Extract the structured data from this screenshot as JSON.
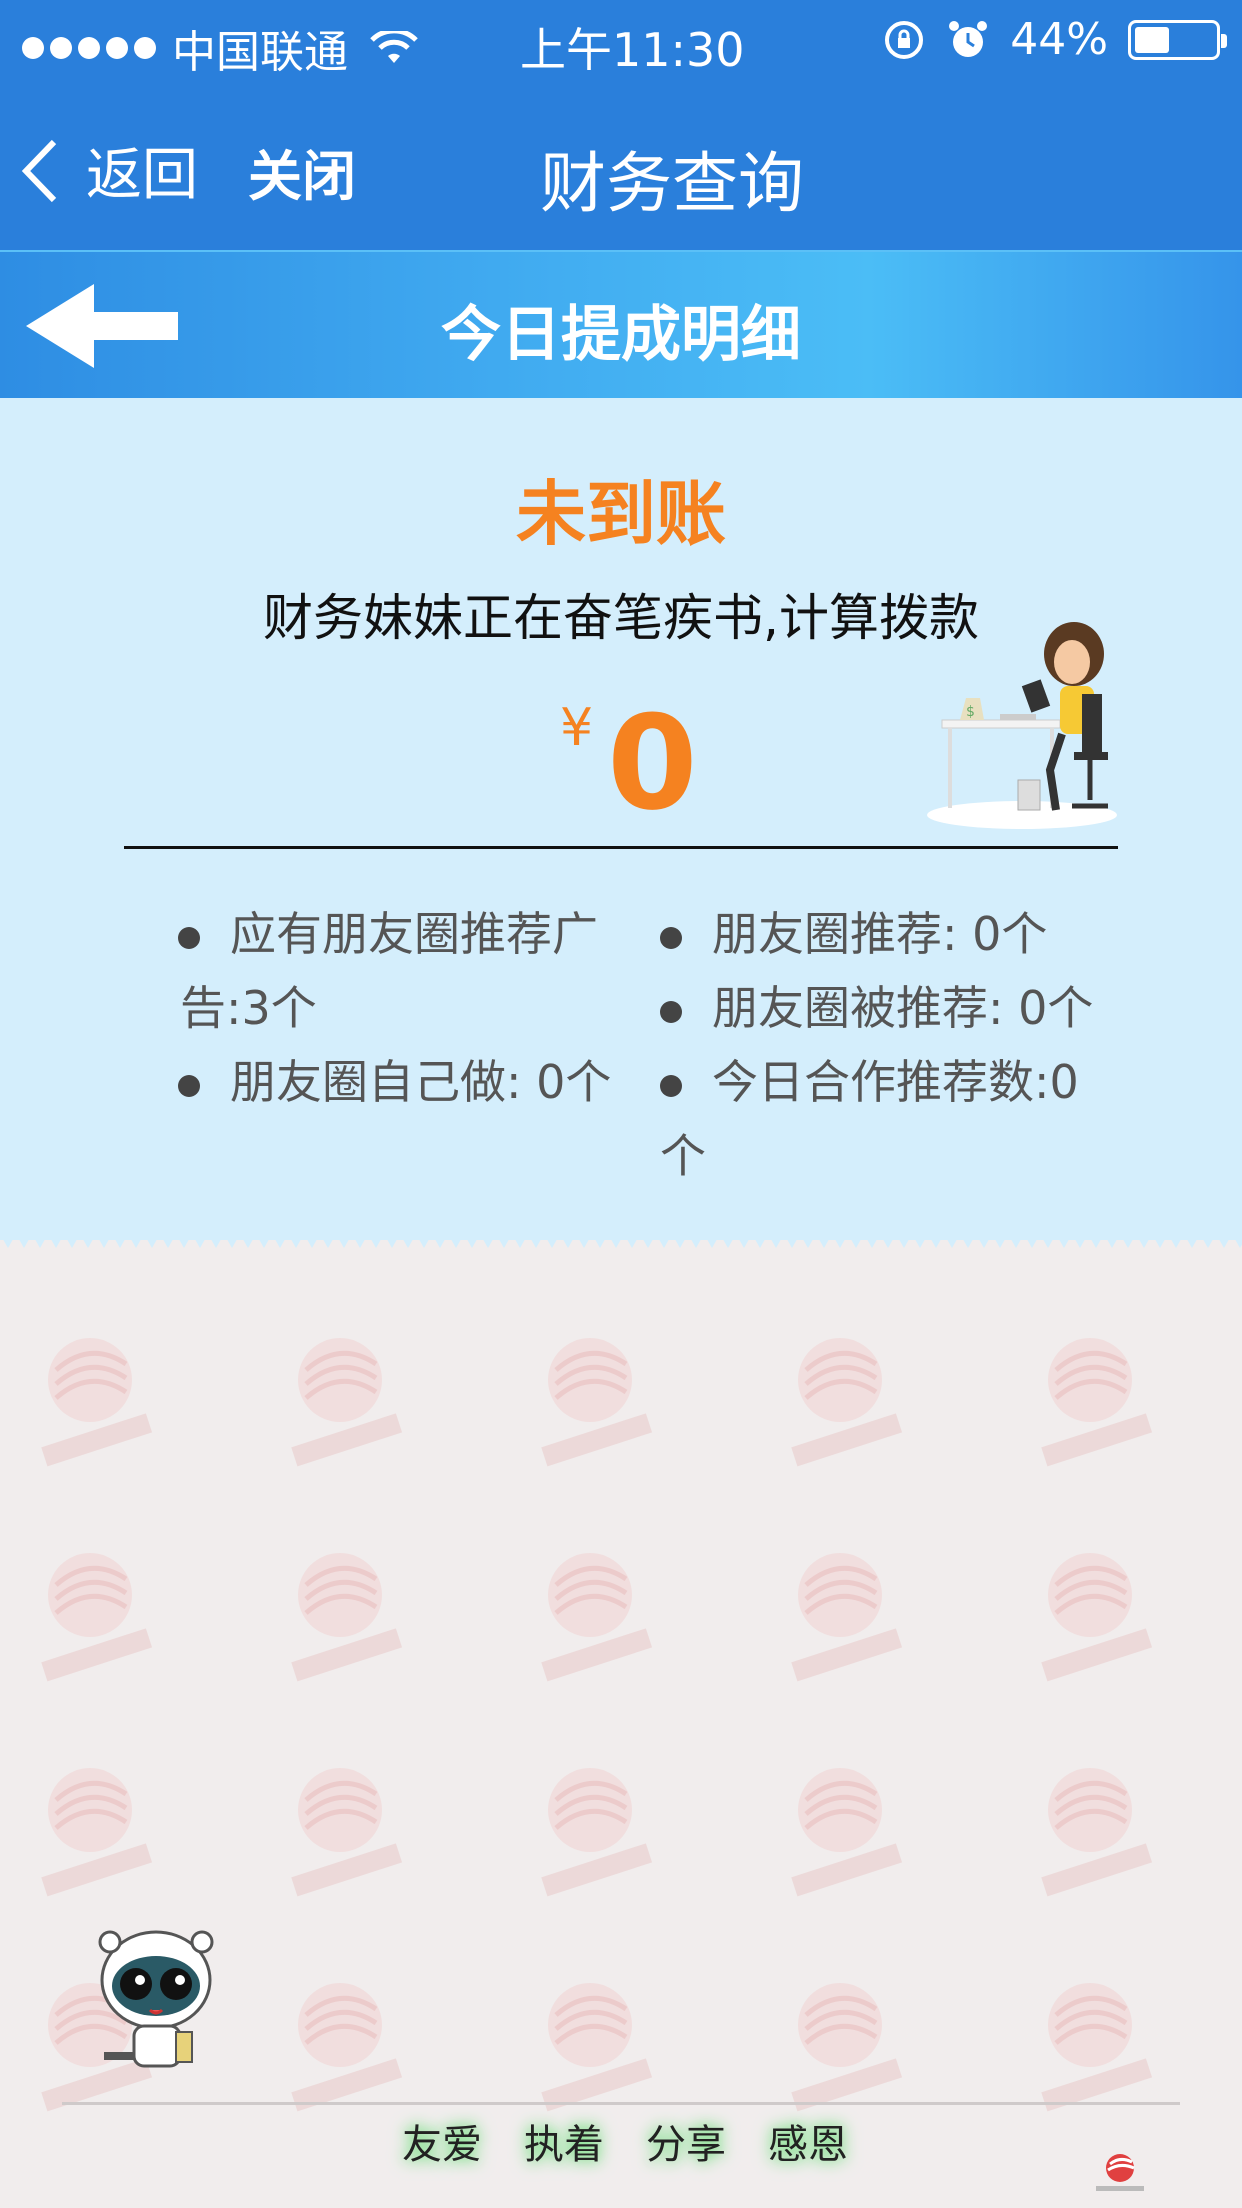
{
  "status_bar": {
    "carrier": "中国联通",
    "time": "上午11:30",
    "battery": "44%",
    "battery_level": 0.44
  },
  "nav": {
    "back_label": "返回",
    "close_label": "关闭",
    "title": "财务查询"
  },
  "section": {
    "title": "今日提成明细"
  },
  "card": {
    "status": "未到账",
    "description": "财务妹妹正在奋笔疾书,计算拨款",
    "currency": "¥",
    "amount": "0"
  },
  "stats": [
    {
      "line1": "应有朋友圈推荐广",
      "line2": "告:3个"
    },
    {
      "line1": "朋友圈推荐: 0个"
    },
    {
      "line1": "朋友圈被推荐: 0个"
    },
    {
      "line1": "朋友圈自己做: 0个"
    },
    {
      "line1": "今日合作推荐数:0",
      "line2": "个"
    }
  ],
  "footer": {
    "words": [
      "友爱",
      "执着",
      "分享",
      "感恩"
    ]
  },
  "colors": {
    "nav_blue": "#2a7fdb",
    "accent_orange": "#f58220",
    "card_bg": "#d4eefc"
  }
}
